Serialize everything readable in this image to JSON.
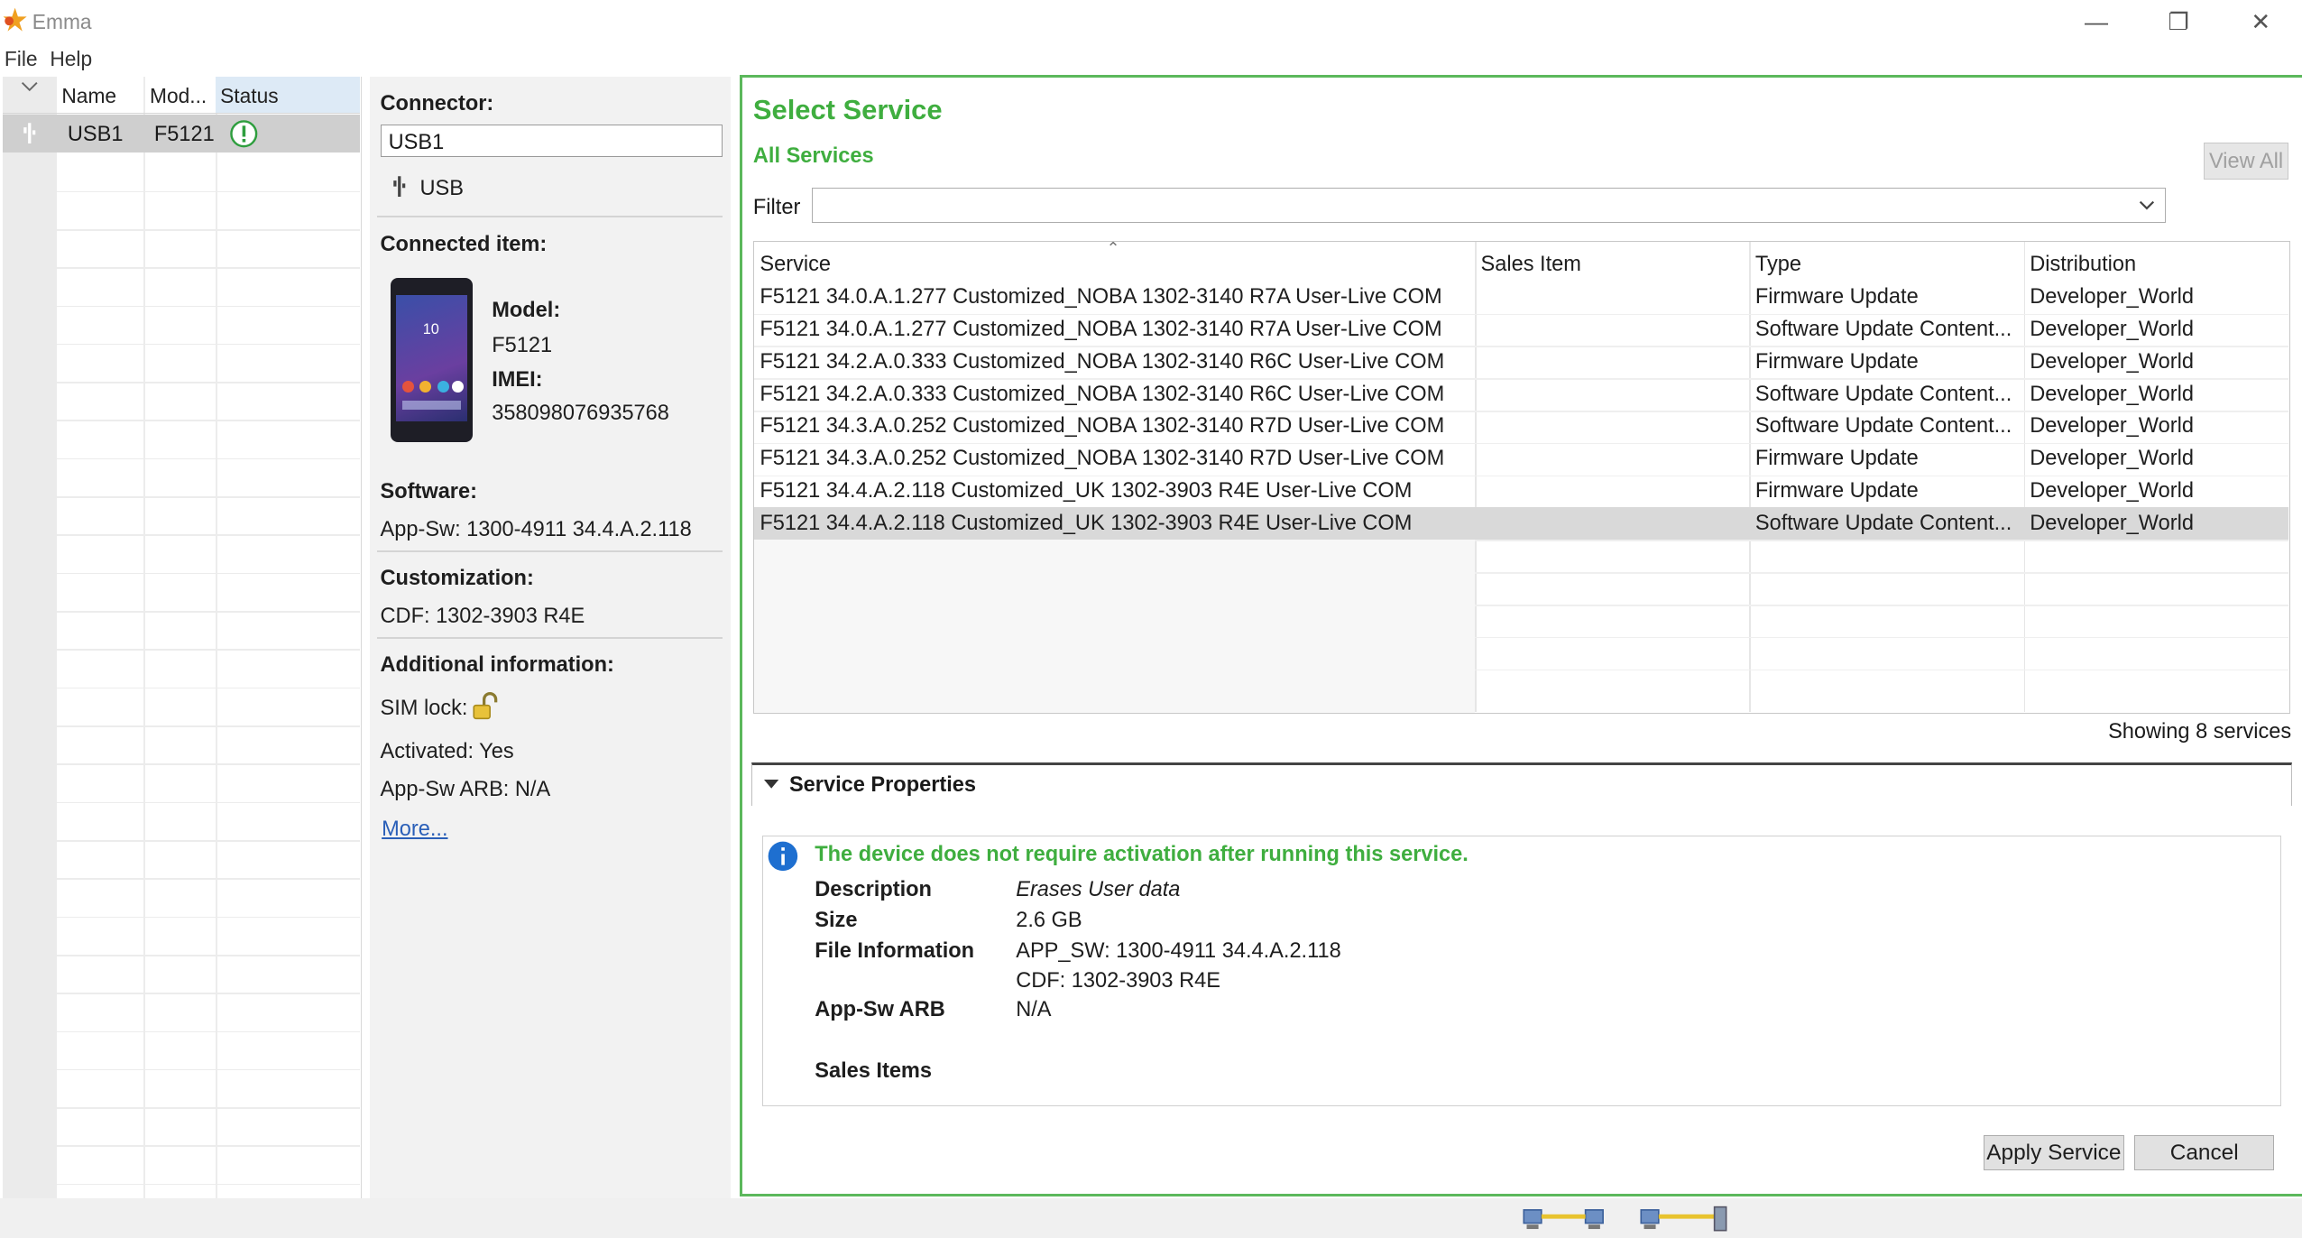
{
  "window": {
    "title": "Emma",
    "minimize_glyph": "—",
    "restore_glyph": "❐",
    "close_glyph": "✕"
  },
  "menu": {
    "items": [
      "File",
      "Help"
    ]
  },
  "device_list": {
    "columns": [
      "Name",
      "Mod...",
      "Status"
    ],
    "rows": [
      {
        "name": "USB1",
        "model": "F5121",
        "status_icon": "warning-exclamation-icon"
      }
    ]
  },
  "device_info": {
    "connector_label": "Connector:",
    "connector_value": "USB1",
    "connector_type": "USB",
    "connected_item_label": "Connected item:",
    "model_label": "Model:",
    "model_value": "F5121",
    "imei_label": "IMEI:",
    "imei_value": "358098076935768",
    "phone_screen_time": "10",
    "software_label": "Software:",
    "software_value": "App-Sw: 1300-4911 34.4.A.2.118",
    "customization_label": "Customization:",
    "customization_value": "CDF: 1302-3903 R4E",
    "additional_label": "Additional information:",
    "sim_lock_label": "SIM lock:",
    "activated_text": "Activated: Yes",
    "arb_text": "App-Sw ARB: N/A",
    "more_link": "More..."
  },
  "main": {
    "title": "Select Service",
    "subtitle": "All Services",
    "view_all_button": "View All",
    "filter_label": "Filter",
    "filter_value": "",
    "sort_glyph": "⌃",
    "columns": [
      "Service",
      "Sales Item",
      "Type",
      "Distribution"
    ],
    "rows": [
      {
        "service": "F5121 34.0.A.1.277 Customized_NOBA 1302-3140 R7A User-Live COM",
        "sales_item": "",
        "type": "Firmware Update",
        "distribution": "Developer_World"
      },
      {
        "service": "F5121 34.0.A.1.277 Customized_NOBA 1302-3140 R7A User-Live COM",
        "sales_item": "",
        "type": "Software Update Content...",
        "distribution": "Developer_World"
      },
      {
        "service": "F5121 34.2.A.0.333 Customized_NOBA 1302-3140 R6C User-Live COM",
        "sales_item": "",
        "type": "Firmware Update",
        "distribution": "Developer_World"
      },
      {
        "service": "F5121 34.2.A.0.333 Customized_NOBA 1302-3140 R6C User-Live COM",
        "sales_item": "",
        "type": "Software Update Content...",
        "distribution": "Developer_World"
      },
      {
        "service": "F5121 34.3.A.0.252 Customized_NOBA 1302-3140 R7D User-Live COM",
        "sales_item": "",
        "type": "Software Update Content...",
        "distribution": "Developer_World"
      },
      {
        "service": "F5121 34.3.A.0.252 Customized_NOBA 1302-3140 R7D User-Live COM",
        "sales_item": "",
        "type": "Firmware Update",
        "distribution": "Developer_World"
      },
      {
        "service": "F5121 34.4.A.2.118 Customized_UK 1302-3903 R4E User-Live COM",
        "sales_item": "",
        "type": "Firmware Update",
        "distribution": "Developer_World"
      },
      {
        "service": "F5121 34.4.A.2.118 Customized_UK 1302-3903 R4E User-Live COM",
        "sales_item": "",
        "type": "Software Update Content...",
        "distribution": "Developer_World"
      }
    ],
    "selected_row_index": 7,
    "showing_text": "Showing 8 services"
  },
  "properties": {
    "header": "Service Properties",
    "notice": "The device does not require activation after running this service.",
    "description_label": "Description",
    "description_value": "Erases User data",
    "size_label": "Size",
    "size_value": "2.6 GB",
    "file_info_label": "File Information",
    "file_info_line1": "APP_SW: 1300-4911 34.4.A.2.118",
    "file_info_line2": "CDF: 1302-3903 R4E",
    "arb_label": "App-Sw ARB",
    "arb_value": "N/A",
    "sales_items_label": "Sales Items"
  },
  "buttons": {
    "apply": "Apply Service",
    "cancel": "Cancel"
  },
  "colors": {
    "accent_green": "#3fae3f",
    "panel_border": "#5cb85c",
    "selected_row": "#d9d9d9"
  }
}
